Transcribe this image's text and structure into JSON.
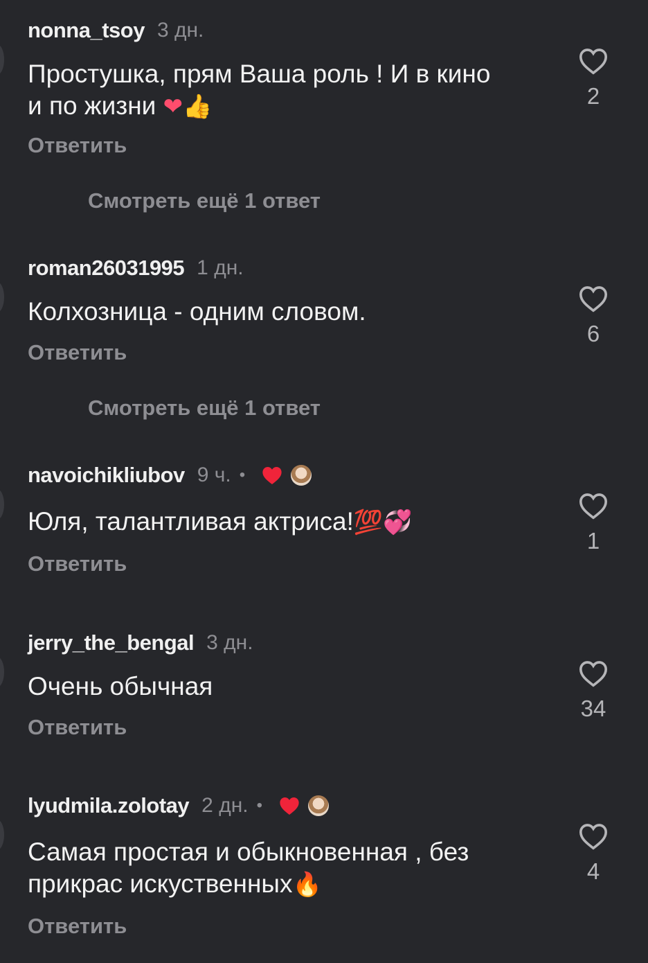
{
  "comments": [
    {
      "username": "nonna_tsoy",
      "time": "3 дн.",
      "text_line1": "Простушка,  прям Ваша роль ! И в кино",
      "text_line2": "и по жизни ",
      "emojis": "❤👍",
      "reply_label": "Ответить",
      "likes": "2",
      "more_replies": "Смотреть ещё 1 ответ"
    },
    {
      "username": "roman26031995",
      "time": "1 дн.",
      "text_line1": "Колхозница - одним словом.",
      "reply_label": "Ответить",
      "likes": "6",
      "more_replies": "Смотреть ещё 1 ответ"
    },
    {
      "username": "navoichikliubov",
      "time": "9 ч.",
      "separator": "•",
      "text_line1": "Юля, талантливая актриса!",
      "emojis": "💯💞",
      "reply_label": "Ответить",
      "likes": "1"
    },
    {
      "username": "jerry_the_bengal",
      "time": "3 дн.",
      "text_line1": "Очень обычная",
      "reply_label": "Ответить",
      "likes": "34"
    },
    {
      "username": "lyudmila.zolotay",
      "time": "2 дн.",
      "separator": "•",
      "text_line1": "Самая простая и обыкновенная , без",
      "text_line2": "прикрас искуственных",
      "emojis": "🔥",
      "reply_label": "Ответить",
      "likes": "4"
    }
  ],
  "icons": {
    "like": "heart-outline-icon",
    "creator_like": "heart-filled-icon"
  },
  "colors": {
    "background": "#26272b",
    "text": "#f2f2f2",
    "muted": "#8e8e93",
    "creator_heart": "#f0243a"
  }
}
